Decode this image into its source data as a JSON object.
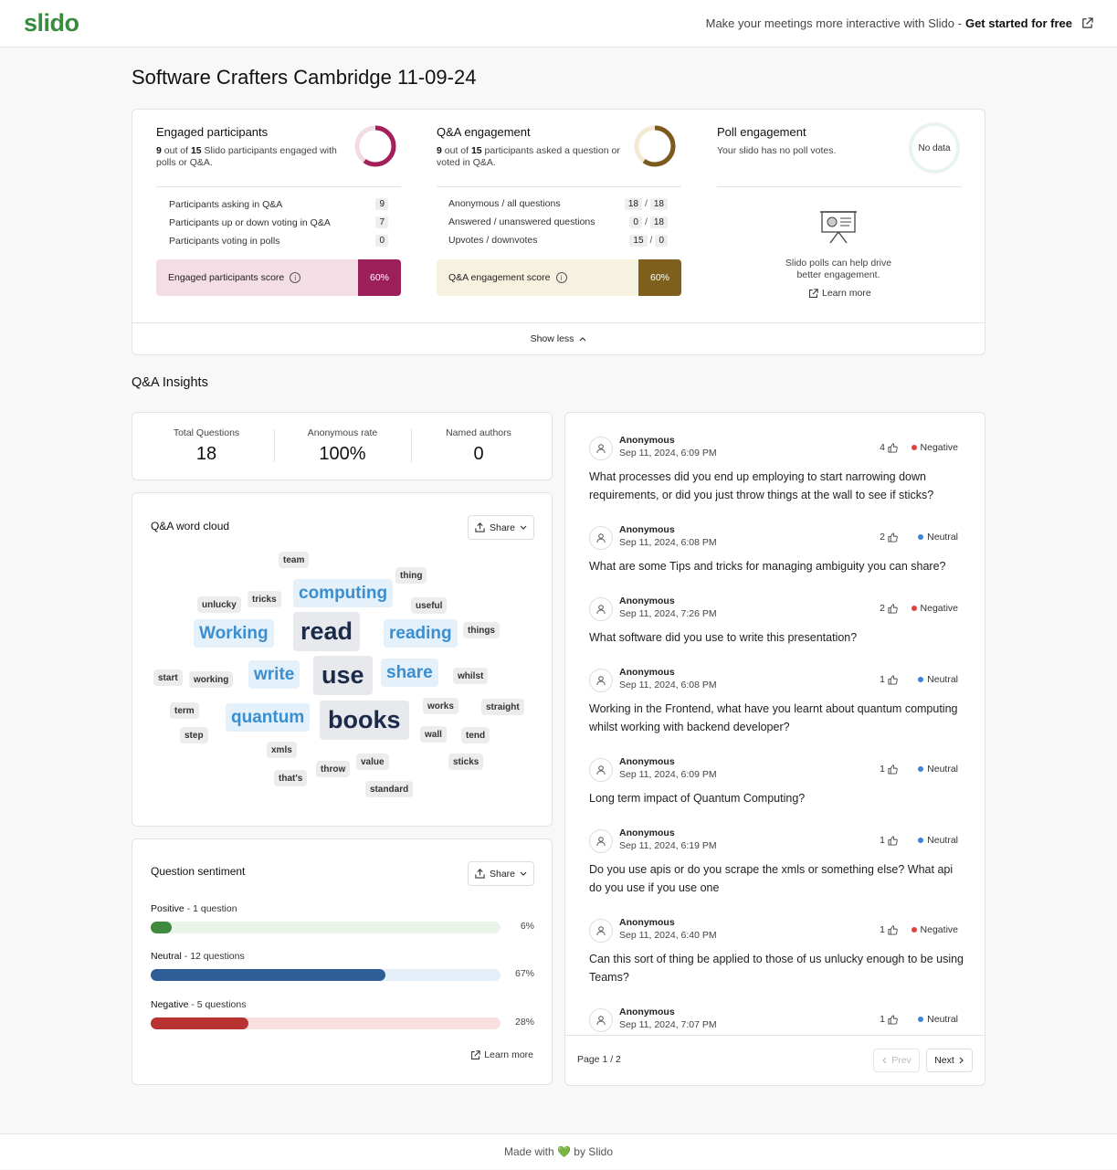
{
  "header": {
    "logo": "slido",
    "promo_text": "Make your meetings more interactive with Slido -",
    "promo_link": "Get started for free"
  },
  "page_title": "Software Crafters Cambridge 11-09-24",
  "engagement": {
    "engaged": {
      "title": "Engaged participants",
      "count": "9",
      "mid1": " out of ",
      "total": "15",
      "desc": " Slido participants engaged with polls or Q&A.",
      "ring_fraction": 0.6,
      "ring_color": "#a3205a",
      "rows": [
        {
          "label": "Participants asking in Q&A",
          "value": "9"
        },
        {
          "label": "Participants up or down voting in Q&A",
          "value": "7"
        },
        {
          "label": "Participants voting in polls",
          "value": "0"
        }
      ],
      "score_label": "Engaged participants score",
      "score_value": "60%",
      "score_bg": "#f5dde6",
      "score_color": "#9c1f59"
    },
    "qa": {
      "title": "Q&A engagement",
      "count": "9",
      "mid1": " out of ",
      "total": "15",
      "desc": " participants asked a question or voted in Q&A.",
      "ring_fraction": 0.6,
      "ring_color": "#7a5a1d",
      "rows": [
        {
          "label": "Anonymous / all questions",
          "a": "18",
          "b": "18"
        },
        {
          "label": "Answered / unanswered questions",
          "a": "0",
          "b": "18"
        },
        {
          "label": "Upvotes / downvotes",
          "a": "15",
          "b": "0"
        }
      ],
      "score_label": "Q&A engagement score",
      "score_value": "60%",
      "score_bg": "#f7f2e0",
      "score_color": "#7e5f1b"
    },
    "poll": {
      "title": "Poll engagement",
      "desc": "Your slido has no poll votes.",
      "ring_label": "No data",
      "promo": "Slido polls can help drive better engagement.",
      "learn_more": "Learn more"
    },
    "show_less": "Show less"
  },
  "insights": {
    "title": "Q&A Insights",
    "stats": [
      {
        "label": "Total Questions",
        "value": "18"
      },
      {
        "label": "Anonymous rate",
        "value": "100%"
      },
      {
        "label": "Named authors",
        "value": "0"
      }
    ]
  },
  "word_cloud": {
    "title": "Q&A word cloud",
    "share": "Share",
    "words": {
      "team": "team",
      "thing": "thing",
      "computing": "computing",
      "unlucky": "unlucky",
      "tricks": "tricks",
      "useful": "useful",
      "working_cap": "Working",
      "read": "read",
      "reading": "reading",
      "things": "things",
      "start": "start",
      "working": "working",
      "write": "write",
      "use": "use",
      "share": "share",
      "whilst": "whilst",
      "term": "term",
      "quantum": "quantum",
      "books": "books",
      "works": "works",
      "straight": "straight",
      "step": "step",
      "wall": "wall",
      "tend": "tend",
      "xmls": "xmls",
      "value": "value",
      "sticks": "sticks",
      "throw": "throw",
      "thats": "that's",
      "standard": "standard"
    }
  },
  "sentiment": {
    "title": "Question sentiment",
    "share": "Share",
    "learn_more": "Learn more",
    "items": [
      {
        "name": "Positive",
        "count_text": " - 1 question",
        "pct": "6%",
        "fraction": 0.06,
        "color": "#3f8a3f",
        "track": "#eaf5ea"
      },
      {
        "name": "Neutral",
        "count_text": " - 12 questions",
        "pct": "67%",
        "fraction": 0.67,
        "color": "#2f5d95",
        "track": "#e3eef8"
      },
      {
        "name": "Negative",
        "count_text": " - 5 questions",
        "pct": "28%",
        "fraction": 0.28,
        "color": "#b83232",
        "track": "#f8e0de"
      }
    ]
  },
  "questions": [
    {
      "author": "Anonymous",
      "date": "Sep 11, 2024, 6:09 PM",
      "votes": "4",
      "sentiment": "Negative",
      "dot": "#e0433b",
      "text": "What processes did you end up employing to start narrowing down requirements, or did you just throw things at the wall to see if sticks?"
    },
    {
      "author": "Anonymous",
      "date": "Sep 11, 2024, 6:08 PM",
      "votes": "2",
      "sentiment": "Neutral",
      "dot": "#3b82d9",
      "text": "What are some Tips and tricks for managing ambiguity you can share?"
    },
    {
      "author": "Anonymous",
      "date": "Sep 11, 2024, 7:26 PM",
      "votes": "2",
      "sentiment": "Negative",
      "dot": "#e0433b",
      "text": "What software did you use to write this presentation?"
    },
    {
      "author": "Anonymous",
      "date": "Sep 11, 2024, 6:08 PM",
      "votes": "1",
      "sentiment": "Neutral",
      "dot": "#3b82d9",
      "text": "Working in the Frontend, what have you learnt about quantum computing whilst working with backend developer?"
    },
    {
      "author": "Anonymous",
      "date": "Sep 11, 2024, 6:09 PM",
      "votes": "1",
      "sentiment": "Neutral",
      "dot": "#3b82d9",
      "text": "Long term impact of Quantum Computing?"
    },
    {
      "author": "Anonymous",
      "date": "Sep 11, 2024, 6:19 PM",
      "votes": "1",
      "sentiment": "Neutral",
      "dot": "#3b82d9",
      "text": "Do you use apis or do you scrape the xmls or something else? What api do you use if you use one"
    },
    {
      "author": "Anonymous",
      "date": "Sep 11, 2024, 6:40 PM",
      "votes": "1",
      "sentiment": "Negative",
      "dot": "#e0433b",
      "text": "Can this sort of thing be applied to those of us unlucky enough to be using Teams?"
    },
    {
      "author": "Anonymous",
      "date": "Sep 11, 2024, 7:07 PM",
      "votes": "1",
      "sentiment": "Neutral",
      "dot": "#3b82d9",
      "text": ""
    }
  ],
  "pagination": {
    "page": "Page 1 / 2",
    "prev": "Prev",
    "next": "Next"
  },
  "footer": {
    "before": "Made with ",
    "heart": "💚",
    "after": " by Slido"
  }
}
